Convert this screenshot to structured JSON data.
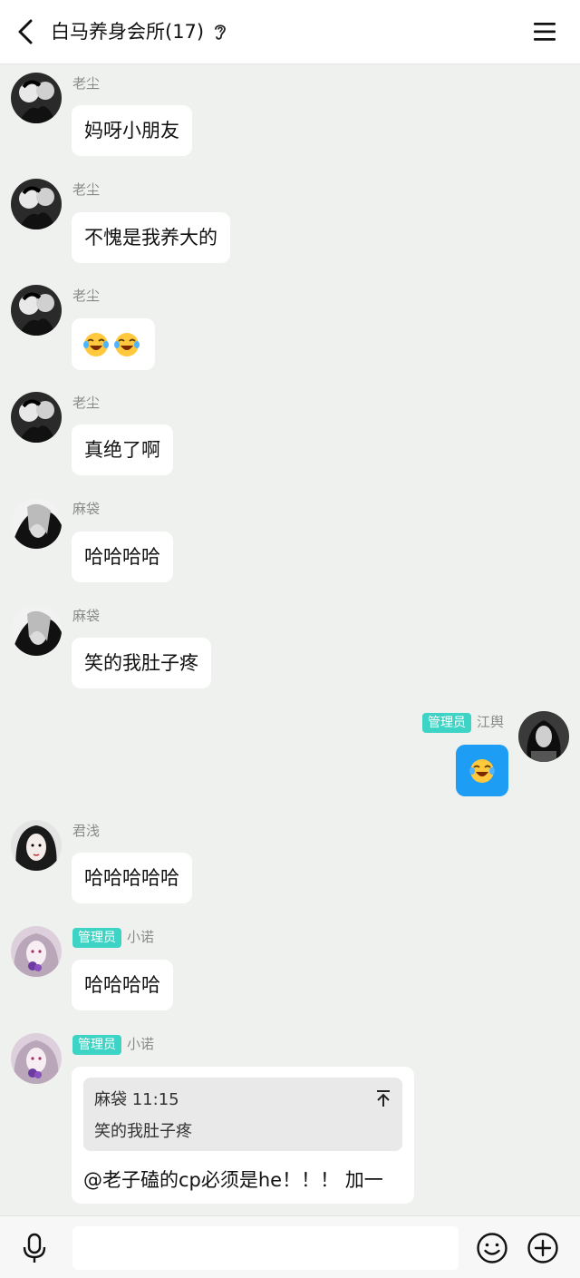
{
  "header": {
    "title": "白马养身会所(17)",
    "back_icon": "chevron-left-icon",
    "listen_icon": "ear-icon",
    "menu_icon": "hamburger-menu-icon"
  },
  "colors": {
    "background": "#eef1ee",
    "bubble": "#ffffff",
    "self_bubble": "#1e9df5",
    "admin_badge": "#3dd4c5"
  },
  "messages": [
    {
      "sender": "老尘",
      "text": "妈呀小朋友"
    },
    {
      "sender": "老尘",
      "text": "不愧是我养大的"
    },
    {
      "sender": "老尘",
      "emoji": [
        "laugh-cry-emoji",
        "laugh-cry-emoji"
      ]
    },
    {
      "sender": "老尘",
      "text": "真绝了啊"
    },
    {
      "sender": "麻袋",
      "text": "哈哈哈哈"
    },
    {
      "sender": "麻袋",
      "text": "笑的我肚子疼"
    },
    {
      "sender": "江舆",
      "badge": "管理员",
      "self": true,
      "emoji": [
        "laugh-cry-emoji"
      ]
    },
    {
      "sender": "君浅",
      "text": "哈哈哈哈哈"
    },
    {
      "sender": "小诺",
      "badge": "管理员",
      "text": "哈哈哈哈"
    },
    {
      "sender": "小诺",
      "badge": "管理员",
      "quote": {
        "author_time": "麻袋 11:15",
        "text": "笑的我肚子疼"
      },
      "text": "@老子磕的cp必须是he！！！ 加一"
    }
  ],
  "composer": {
    "voice_icon": "microphone-icon",
    "emoji_icon": "smiley-icon",
    "add_icon": "plus-circle-icon",
    "input_value": ""
  }
}
